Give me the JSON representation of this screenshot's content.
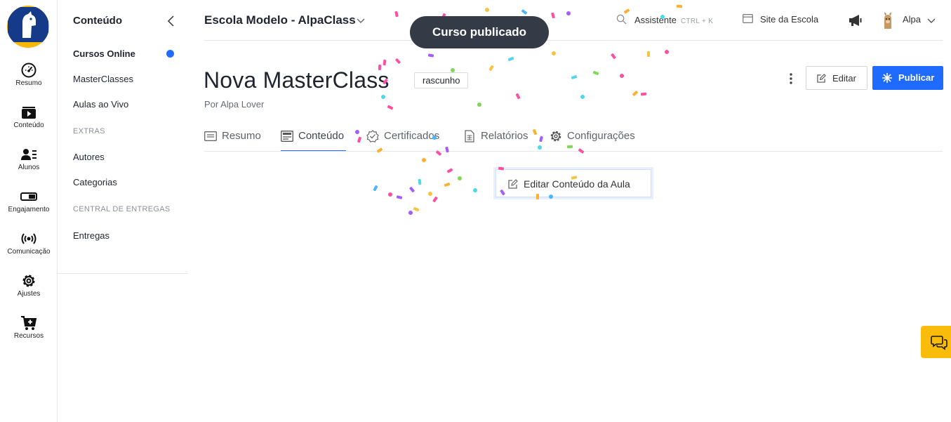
{
  "colors": {
    "accent": "#1f6bff",
    "brand_navy": "#163a8a",
    "brand_yellow": "#f6b70b",
    "toast_bg": "#343b47"
  },
  "rail": [
    {
      "label": "Resumo",
      "icon": "dashboard-icon"
    },
    {
      "label": "Conteúdo",
      "icon": "video-play-icon"
    },
    {
      "label": "Alunos",
      "icon": "users-icon"
    },
    {
      "label": "Engajamento",
      "icon": "toggle-icon"
    },
    {
      "label": "Comunicação",
      "icon": "broadcast-icon"
    },
    {
      "label": "Ajustes",
      "icon": "gear-icon"
    },
    {
      "label": "Recursos",
      "icon": "cart-icon"
    }
  ],
  "sidebar": {
    "title": "Conteúdo",
    "items": [
      "Cursos Online",
      "MasterClasses",
      "Aulas ao Vivo"
    ],
    "section_extras": "EXTRAS",
    "extras": [
      "Autores",
      "Categorias"
    ],
    "section_deliveries": "CENTRAL DE ENTREGAS",
    "deliveries": [
      "Entregas"
    ]
  },
  "header": {
    "school": "Escola Modelo - AlpaClass",
    "assistant": "Assistente",
    "shortcut": "CTRL + K",
    "site": "Site da Escola",
    "user": "Alpa"
  },
  "toast": "Curso publicado",
  "course": {
    "title": "Nova MasterClass",
    "status": "rascunho",
    "author": "Por Alpa Lover",
    "edit_label": "Editar",
    "publish_label": "Publicar"
  },
  "tabs": [
    {
      "label": "Resumo",
      "icon": "summary-icon"
    },
    {
      "label": "Conteúdo",
      "icon": "content-icon",
      "active": true
    },
    {
      "label": "Certificados",
      "icon": "certificate-icon"
    },
    {
      "label": "Relatórios",
      "icon": "report-icon"
    },
    {
      "label": "Configurações",
      "icon": "settings-icon"
    }
  ],
  "content": {
    "edit_lesson": "Editar Conteúdo da Aula"
  }
}
